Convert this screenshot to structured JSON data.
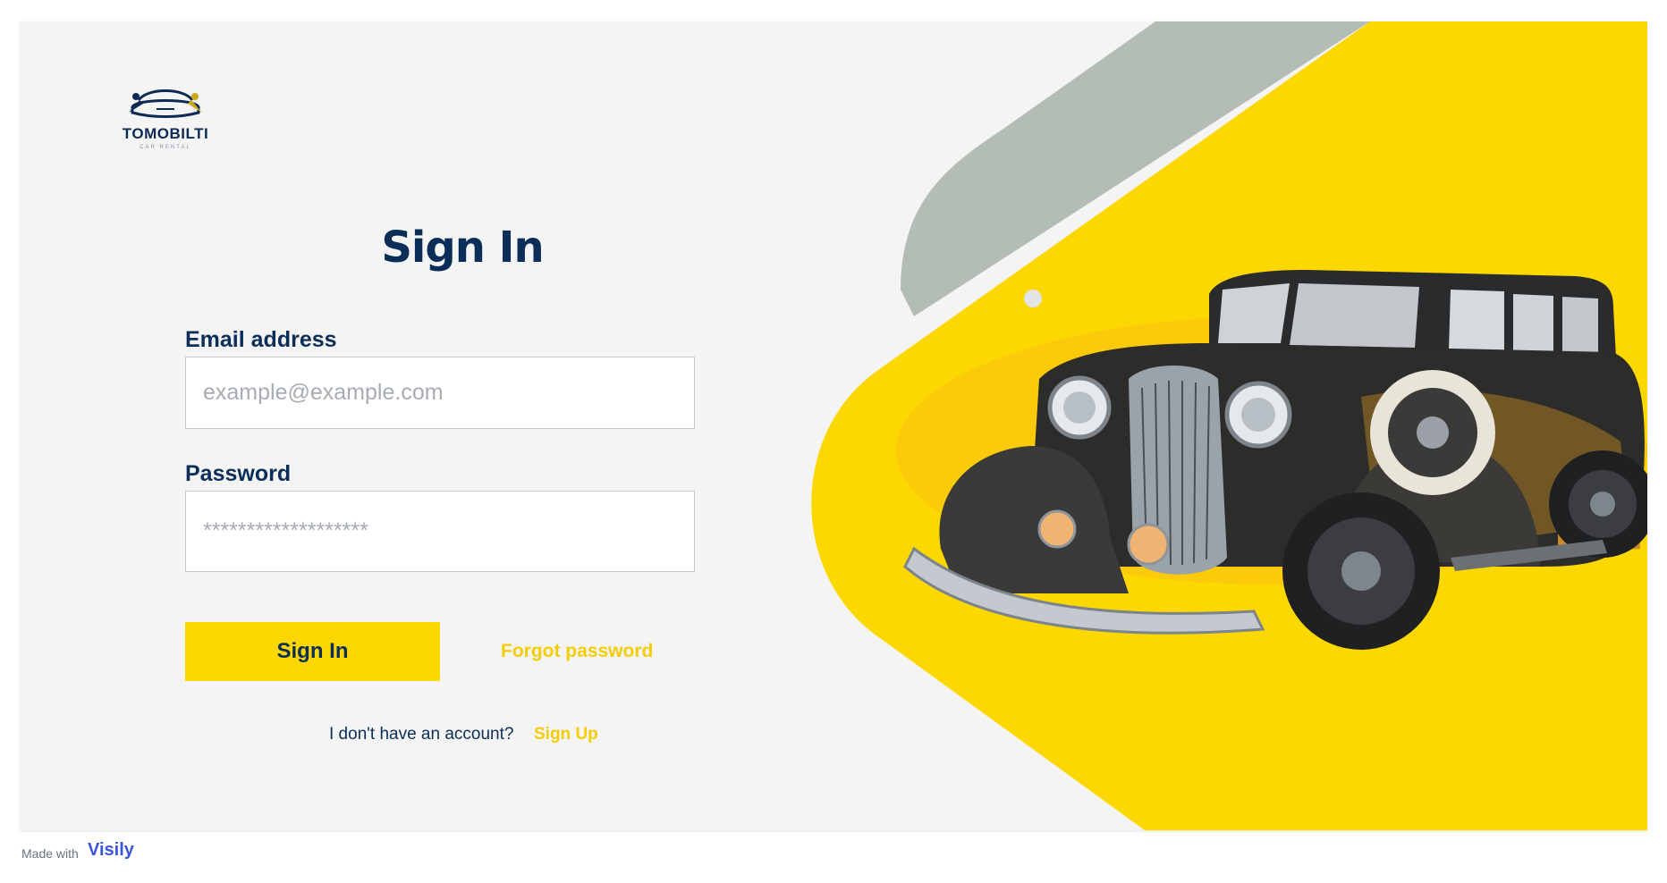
{
  "brand": {
    "name": "TOMOBILTI",
    "tagline": "CAR RENTAL"
  },
  "form": {
    "title": "Sign In",
    "email": {
      "label": "Email address",
      "placeholder": "example@example.com"
    },
    "password": {
      "label": "Password",
      "placeholder": "*******************"
    },
    "submit_label": "Sign In",
    "forgot_label": "Forgot password",
    "no_account_text": "I don't have an account?",
    "signup_label": "Sign Up"
  },
  "footer": {
    "made_with": "Made with",
    "tool_name": "Visily"
  },
  "colors": {
    "accent_yellow": "#fdd700",
    "navy": "#0b2e59",
    "sage": "#b3bdb5",
    "panel_bg": "#f4f4f4"
  },
  "icons": {
    "logo": "car-logo-icon",
    "hero": "vintage-car-illustration"
  }
}
